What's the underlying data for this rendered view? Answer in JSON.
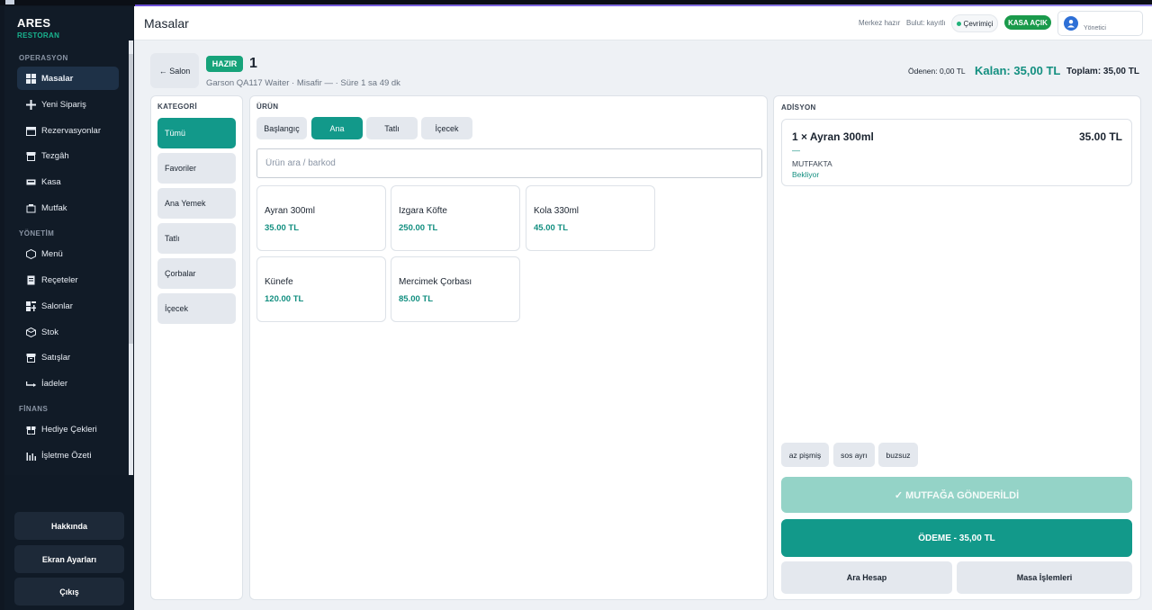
{
  "window": {
    "title": "ARES RESTORAN"
  },
  "brand": {
    "title": "ARES",
    "subtitle": "RESTORAN"
  },
  "sidebar": {
    "sections": {
      "operations": "OPERASYON",
      "management": "YÖNETİM",
      "finance": "FİNANS"
    },
    "items": [
      {
        "label": "Masalar",
        "icon": "grid-icon"
      },
      {
        "label": "Yeni Sipariş",
        "icon": "plus-icon"
      },
      {
        "label": "Rezervasyonlar",
        "icon": "calendar-icon"
      },
      {
        "label": "Tezgâh",
        "icon": "store-icon"
      },
      {
        "label": "Kasa",
        "icon": "cash-icon"
      },
      {
        "label": "Mutfak",
        "icon": "kitchen-icon"
      },
      {
        "label": "Menü",
        "icon": "hexagon-icon"
      },
      {
        "label": "Reçeteler",
        "icon": "recipe-icon"
      },
      {
        "label": "Salonlar",
        "icon": "layout-icon"
      },
      {
        "label": "Stok",
        "icon": "box-icon"
      },
      {
        "label": "Satışlar",
        "icon": "sales-icon"
      },
      {
        "label": "İadeler",
        "icon": "return-icon"
      },
      {
        "label": "Hediye Çekleri",
        "icon": "gift-icon"
      },
      {
        "label": "İşletme Özeti",
        "icon": "bar-chart-icon"
      }
    ],
    "bottom": {
      "about": "Hakkında",
      "screen_settings": "Ekran Ayarları",
      "logout": "Çıkış"
    }
  },
  "topbar": {
    "title": "Masalar",
    "center_status": "Merkez hazır",
    "cloud_status": "Bulut: kayıtlı",
    "online": "Çevrimiçi",
    "register": "KASA AÇIK",
    "user_role": "Yönetici"
  },
  "table": {
    "back": "← Salon",
    "status": "HAZIR",
    "number": "1",
    "meta": "Garson QA117 Waiter · Misafir — · Süre 1 sa 49 dk",
    "paid": "Ödenen: 0,00 TL",
    "remaining": "Kalan: 35,00 TL",
    "total": "Toplam: 35,00 TL"
  },
  "categories": {
    "label": "KATEGORİ",
    "items": [
      "Tümü",
      "Favoriler",
      "Ana Yemek",
      "Tatlı",
      "Çorbalar",
      "İçecek"
    ]
  },
  "products": {
    "label": "ÜRÜN",
    "tabs": [
      "Başlangıç",
      "Ana",
      "Tatlı",
      "İçecek"
    ],
    "search_placeholder": "Ürün ara / barkod",
    "items": [
      {
        "name": "Ayran 300ml",
        "price": "35.00 TL"
      },
      {
        "name": "Izgara Köfte",
        "price": "250.00 TL"
      },
      {
        "name": "Kola 330ml",
        "price": "45.00 TL"
      },
      {
        "name": "Künefe",
        "price": "120.00 TL"
      },
      {
        "name": "Mercimek Çorbası",
        "price": "85.00 TL"
      }
    ]
  },
  "order": {
    "label": "ADİSYON",
    "items": [
      {
        "name": "1 × Ayran 300ml",
        "price": "35.00 TL",
        "dash": "—",
        "station": "MUTFAKTA",
        "status": "Bekliyor"
      }
    ],
    "notes": [
      "az pişmiş",
      "sos ayrı",
      "buzsuz"
    ],
    "kitchen_sent": "✓ MUTFAĞA GÖNDERİLDİ",
    "pay": "ÖDEME - 35,00 TL",
    "split": "Ara Hesap",
    "table_actions": "Masa İşlemleri"
  },
  "colors": {
    "accent": "#12998a",
    "sidebar": "#111b27",
    "success": "#1a9a4b"
  }
}
